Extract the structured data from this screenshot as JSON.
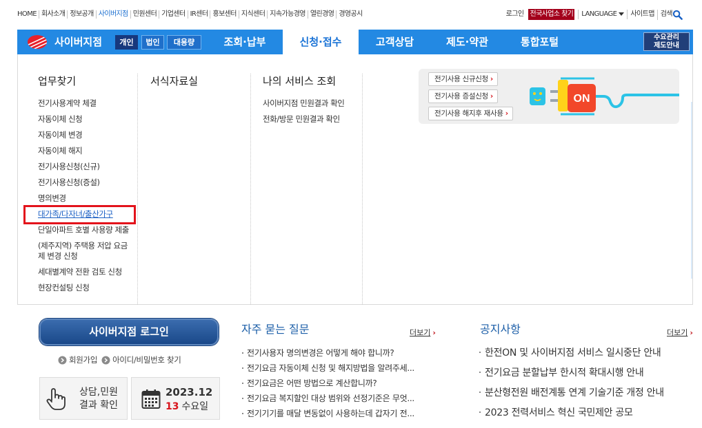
{
  "utility": {
    "links": [
      "HOME",
      "회사소개",
      "정보공개",
      "사이버지점",
      "민원센터",
      "기업센터",
      "IR센터",
      "홍보센터",
      "지식센터",
      "지속가능경영",
      "열린경영",
      "경영공시"
    ],
    "active_link": "사이버지점",
    "login": "로그인",
    "branch_finder": "전국사업소 찾기",
    "language": "LANGUAGE",
    "sitemap": "사이트맵",
    "search": "검색",
    "search_icon": "search-icon"
  },
  "gnb": {
    "logo_icon": "kepco-logo-icon",
    "logo_text": "사이버지점",
    "customer_types": [
      {
        "label": "개인",
        "selected": true
      },
      {
        "label": "법인",
        "selected": false
      },
      {
        "label": "대용량",
        "selected": false
      }
    ],
    "menu": [
      {
        "label": "조회·납부",
        "active": false
      },
      {
        "label": "신청·접수",
        "active": true
      },
      {
        "label": "고객상담",
        "active": false
      },
      {
        "label": "제도·약관",
        "active": false
      },
      {
        "label": "통합포털",
        "active": false
      }
    ],
    "demand_guide": {
      "line1": "수요관리",
      "line2": "제도안내"
    }
  },
  "dropdown": {
    "work_finder": {
      "heading": "업무찾기",
      "items": [
        "전기사용계약 체결",
        "자동이체 신청",
        "자동이체 변경",
        "자동이체 해지",
        "전기사용신청(신규)",
        "전기사용신청(증설)",
        "명의변경",
        "대가족/다자녀/출산가구",
        "단일아파트 호별 사용량 제출",
        "(제주지역) 주택용 저압 요금제 변경 신청",
        "세대별계약 전환 검토 신청",
        "현장컨설팅 신청"
      ],
      "highlighted_item": "대가족/다자녀/출산가구"
    },
    "forms": {
      "heading": "서식자료실"
    },
    "my_service": {
      "heading": "나의 서비스 조회",
      "items": [
        "사이버지점 민원결과 확인",
        "전화/방문 민원결과 확인"
      ]
    },
    "quick_apply": {
      "buttons": [
        "전기사용 신규신청",
        "전기사용 증설신청",
        "전기사용 해지후 재사용"
      ],
      "arrow": "›",
      "plug_label": "ON",
      "illustration": "plug-socket-illustration"
    }
  },
  "login_box": {
    "login_button": "사이버지점 로그인",
    "links": [
      {
        "label": "회원가입",
        "icon": "circle-arrow-icon"
      },
      {
        "label": "아이디/비밀번호 찾기",
        "icon": "circle-arrow-icon"
      }
    ],
    "result_check": {
      "line1": "상담,민원",
      "line2": "결과 확인",
      "icon": "hand-pointer-icon"
    },
    "date": {
      "year_month": "2023.12",
      "day": "13",
      "weekday": "수요일",
      "icon": "calendar-icon"
    }
  },
  "faq": {
    "heading": "자주 묻는 질문",
    "more": "더보기",
    "more_arrow": "›",
    "items": [
      "전기사용자 명의변경은 어떻게 해야 합니까?",
      "전기요금 자동이체 신청 및 해지방법을 알려주세...",
      "전기요금은 어떤 방법으로 계산합니까?",
      "전기요금 복지할인 대상 범위와 선정기준은 무엇...",
      "전기기기를 매달 변동없이 사용하는데 갑자기 전..."
    ]
  },
  "notice": {
    "heading": "공지사항",
    "more": "더보기",
    "more_arrow": "›",
    "items": [
      "한전ON 및 사이버지점 서비스 일시중단 안내",
      "전기요금 분할납부 한시적 확대시행 안내",
      "분산형전원 배전계통 연계 기술기준 개정 안내",
      "2023 전력서비스 혁신 국민제안 공모"
    ]
  },
  "colors": {
    "gnb_blue": "#2389e3",
    "active_tab_text": "#1a73d6",
    "selected_type": "#17387d",
    "branch_finder_bg": "#a3001b",
    "highlight_box": "#e3131b",
    "section_heading": "#1d5fa8",
    "date_red": "#d8141c"
  }
}
